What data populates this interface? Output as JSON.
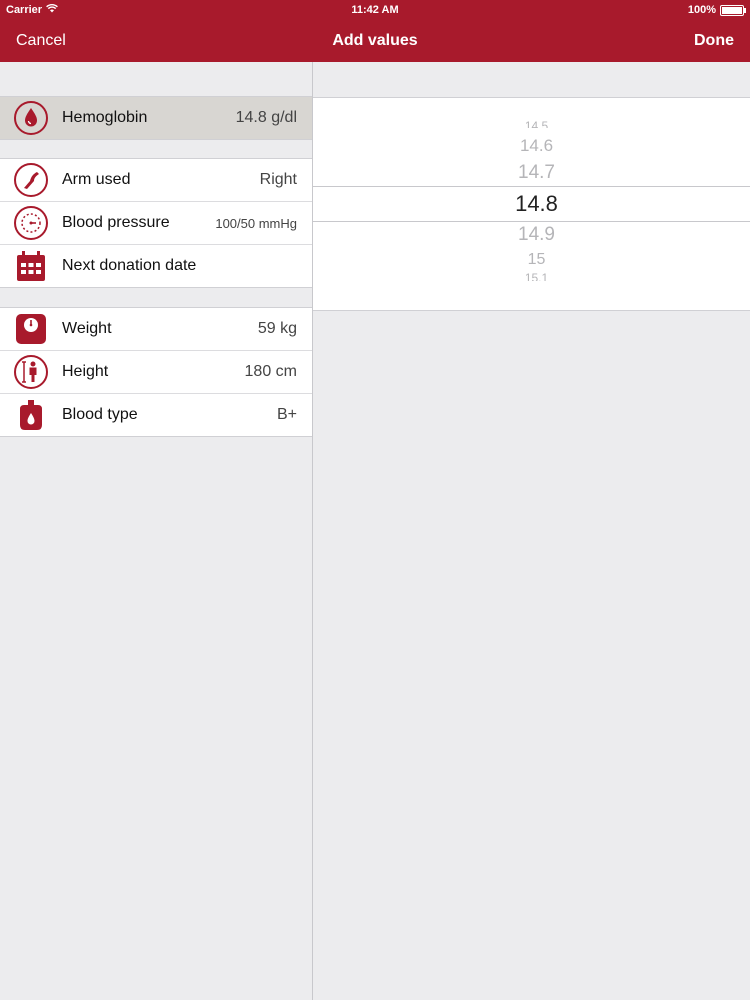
{
  "status": {
    "carrier": "Carrier",
    "time": "11:42 AM",
    "battery": "100%"
  },
  "nav": {
    "cancel": "Cancel",
    "title": "Add values",
    "done": "Done"
  },
  "accent_color": "#a81a2c",
  "groups": [
    [
      {
        "label": "Hemoglobin",
        "value": "14.8 g/dl",
        "icon": "blood-drop-icon"
      }
    ],
    [
      {
        "label": "Arm used",
        "value": "Right",
        "icon": "arm-icon"
      },
      {
        "label": "Blood pressure",
        "value": "100/50 mmHg",
        "icon": "pressure-gauge-icon"
      },
      {
        "label": "Next donation date",
        "value": "",
        "icon": "calendar-icon"
      }
    ],
    [
      {
        "label": "Weight",
        "value": "59 kg",
        "icon": "scale-icon"
      },
      {
        "label": "Height",
        "value": "180 cm",
        "icon": "height-icon"
      },
      {
        "label": "Blood type",
        "value": "B+",
        "icon": "blood-bag-icon"
      }
    ]
  ],
  "picker": {
    "values": [
      "14.5",
      "14.6",
      "14.7",
      "14.8",
      "14.9",
      "15",
      "15.1"
    ],
    "selected": "14.8"
  }
}
